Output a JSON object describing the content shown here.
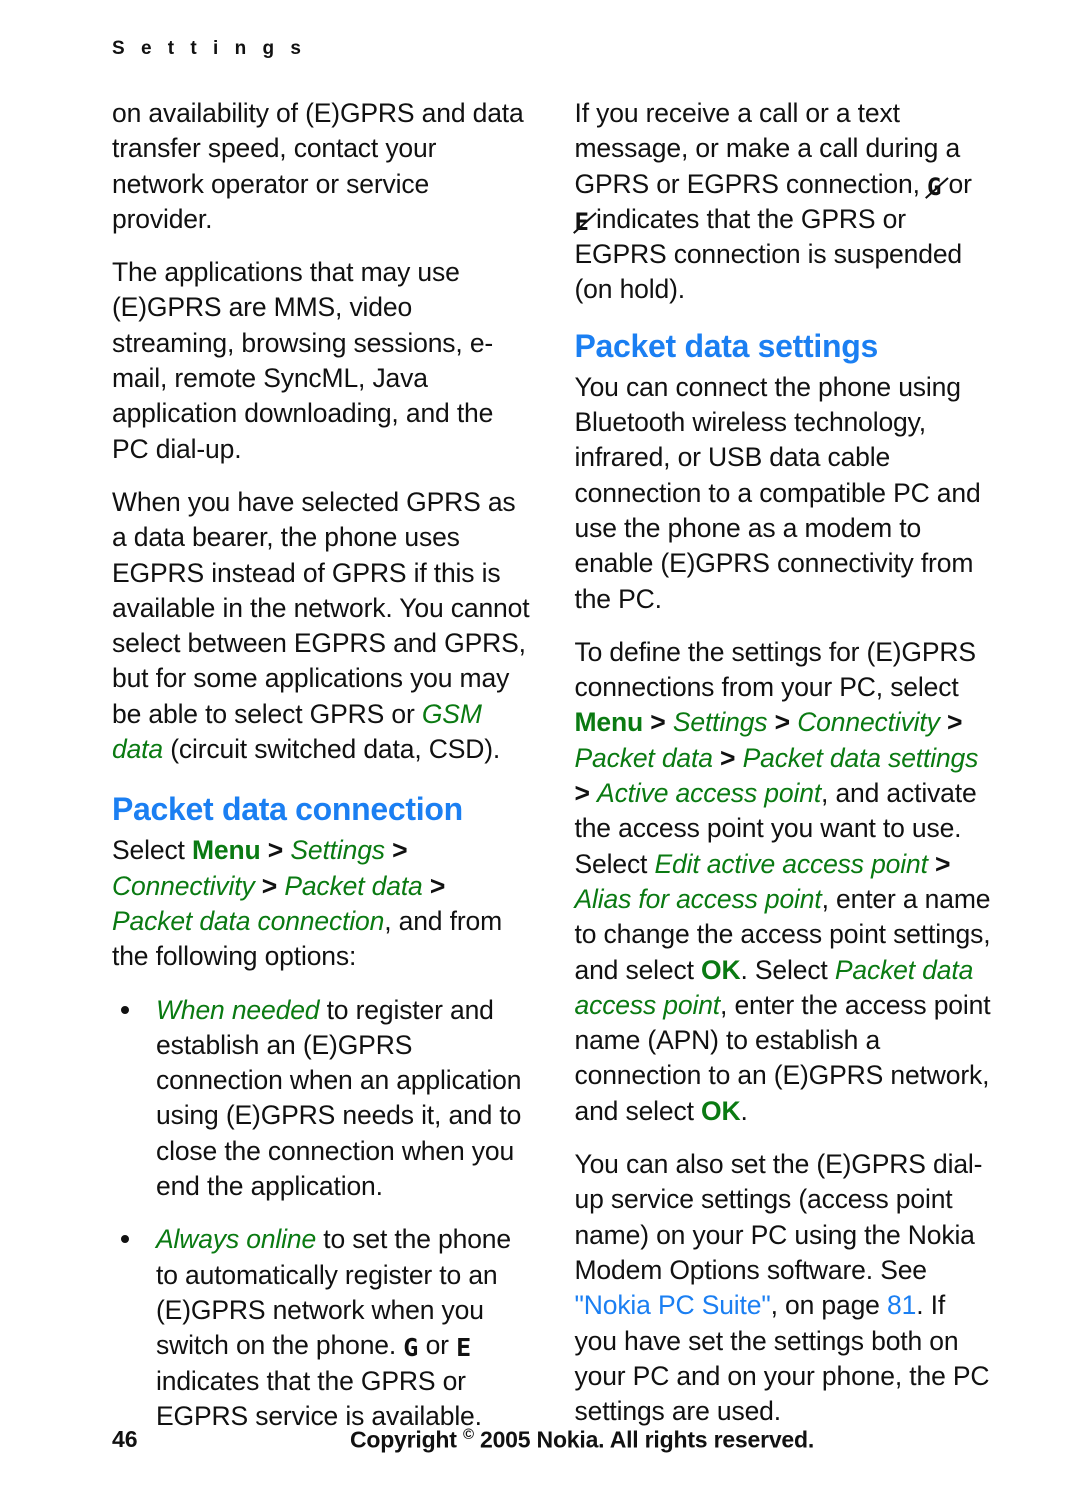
{
  "document": {
    "running_header": "S e t t i n g s",
    "colors": {
      "heading_blue": "#1b7ff2",
      "menu_green": "#0a7a12",
      "link_blue": "#1b7ff2",
      "text_black": "#111111"
    }
  },
  "left_column": {
    "para_1": "on availability of (E)GPRS and data transfer speed, contact your network operator or service provider.",
    "para_2": "The applications that may use (E)GPRS are MMS, video streaming, browsing sessions, e-mail, remote SyncML, Java application downloading, and the PC dial-up.",
    "para_3_a": "When you have selected GPRS as a data bearer, the phone uses EGPRS instead of GPRS if this is available in the network. You cannot select between EGPRS and GPRS, but for some applications you may be able to select GPRS or ",
    "para_3_em": "GSM data",
    "para_3_b": " (circuit switched data, CSD).",
    "heading": "Packet data connection",
    "intro_a": "Select ",
    "intro_menu": "Menu",
    "intro_sep1": " > ",
    "intro_settings": "Settings",
    "intro_sep2": " > ",
    "intro_connectivity": "Connectivity",
    "intro_sep3": " > ",
    "intro_packetdata": "Packet data",
    "intro_sep4": " > ",
    "intro_pdc": "Packet data connection",
    "intro_b": ", and from the following options:",
    "bullets": [
      {
        "em": "When needed",
        "text": " to register and establish an (E)GPRS connection when an application using (E)GPRS needs it, and to close the connection when you end the application."
      },
      {
        "em": "Always online",
        "text_a": " to set the phone to automatically register to an (E)GPRS network when you switch on the phone. ",
        "icon_1": "G",
        "icon_1_name": "gprs-available-icon",
        "text_mid": " or ",
        "icon_2": "E",
        "icon_2_name": "egprs-available-icon",
        "text_b": " indicates that the GPRS or EGPRS service is available."
      }
    ]
  },
  "right_column": {
    "para_1_a": "If you receive a call or a text message, or make a call during a GPRS or EGPRS connection, ",
    "para_1_icon_1": "G",
    "para_1_mid": " or ",
    "para_1_icon_2": "E",
    "para_1_b": " indicates that the GPRS or EGPRS connection is suspended (on hold).",
    "heading": "Packet data settings",
    "para_2": "You can connect the phone using Bluetooth wireless technology, infrared, or USB data cable connection to a compatible PC and use the phone as a modem to enable (E)GPRS connectivity from the PC.",
    "para_3_a": "To define the settings for (E)GPRS connections from your PC, select ",
    "para_3_menu": "Menu",
    "para_3_sep1": " > ",
    "para_3_settings": "Settings",
    "para_3_sep2": " > ",
    "para_3_connectivity": "Connectivity",
    "para_3_sep3": " > ",
    "para_3_packetdata": "Packet data",
    "para_3_sep4": " > ",
    "para_3_pds": "Packet data settings",
    "para_3_sep5": " > ",
    "para_3_aap": "Active access point",
    "para_3_b": ", and activate the access point you want to use. Select ",
    "para_3_eaap": "Edit active access point",
    "para_3_sep6": " > ",
    "para_3_alias": "Alias for access point",
    "para_3_c": ", enter a name to change the access point settings, and select ",
    "para_3_ok1": "OK",
    "para_3_d": ". Select ",
    "para_3_pdap": "Packet data access point",
    "para_3_e": ", enter the access point name (APN) to establish a connection to an (E)GPRS network, and select ",
    "para_3_ok2": "OK",
    "para_3_f": ".",
    "para_4_a": "You can also set the (E)GPRS dial-up service settings (access point name) on your PC using the Nokia Modem Options software. See ",
    "para_4_link": "\"Nokia PC Suite\"",
    "para_4_b": ", on page ",
    "para_4_page": "81",
    "para_4_c": ". If you have set the settings both on your PC and on your phone, the PC settings are used."
  },
  "footer": {
    "page_number": "46",
    "copyright_pre": "Copyright ",
    "copyright_symbol": "©",
    "copyright_post": " 2005 Nokia. All rights reserved."
  }
}
